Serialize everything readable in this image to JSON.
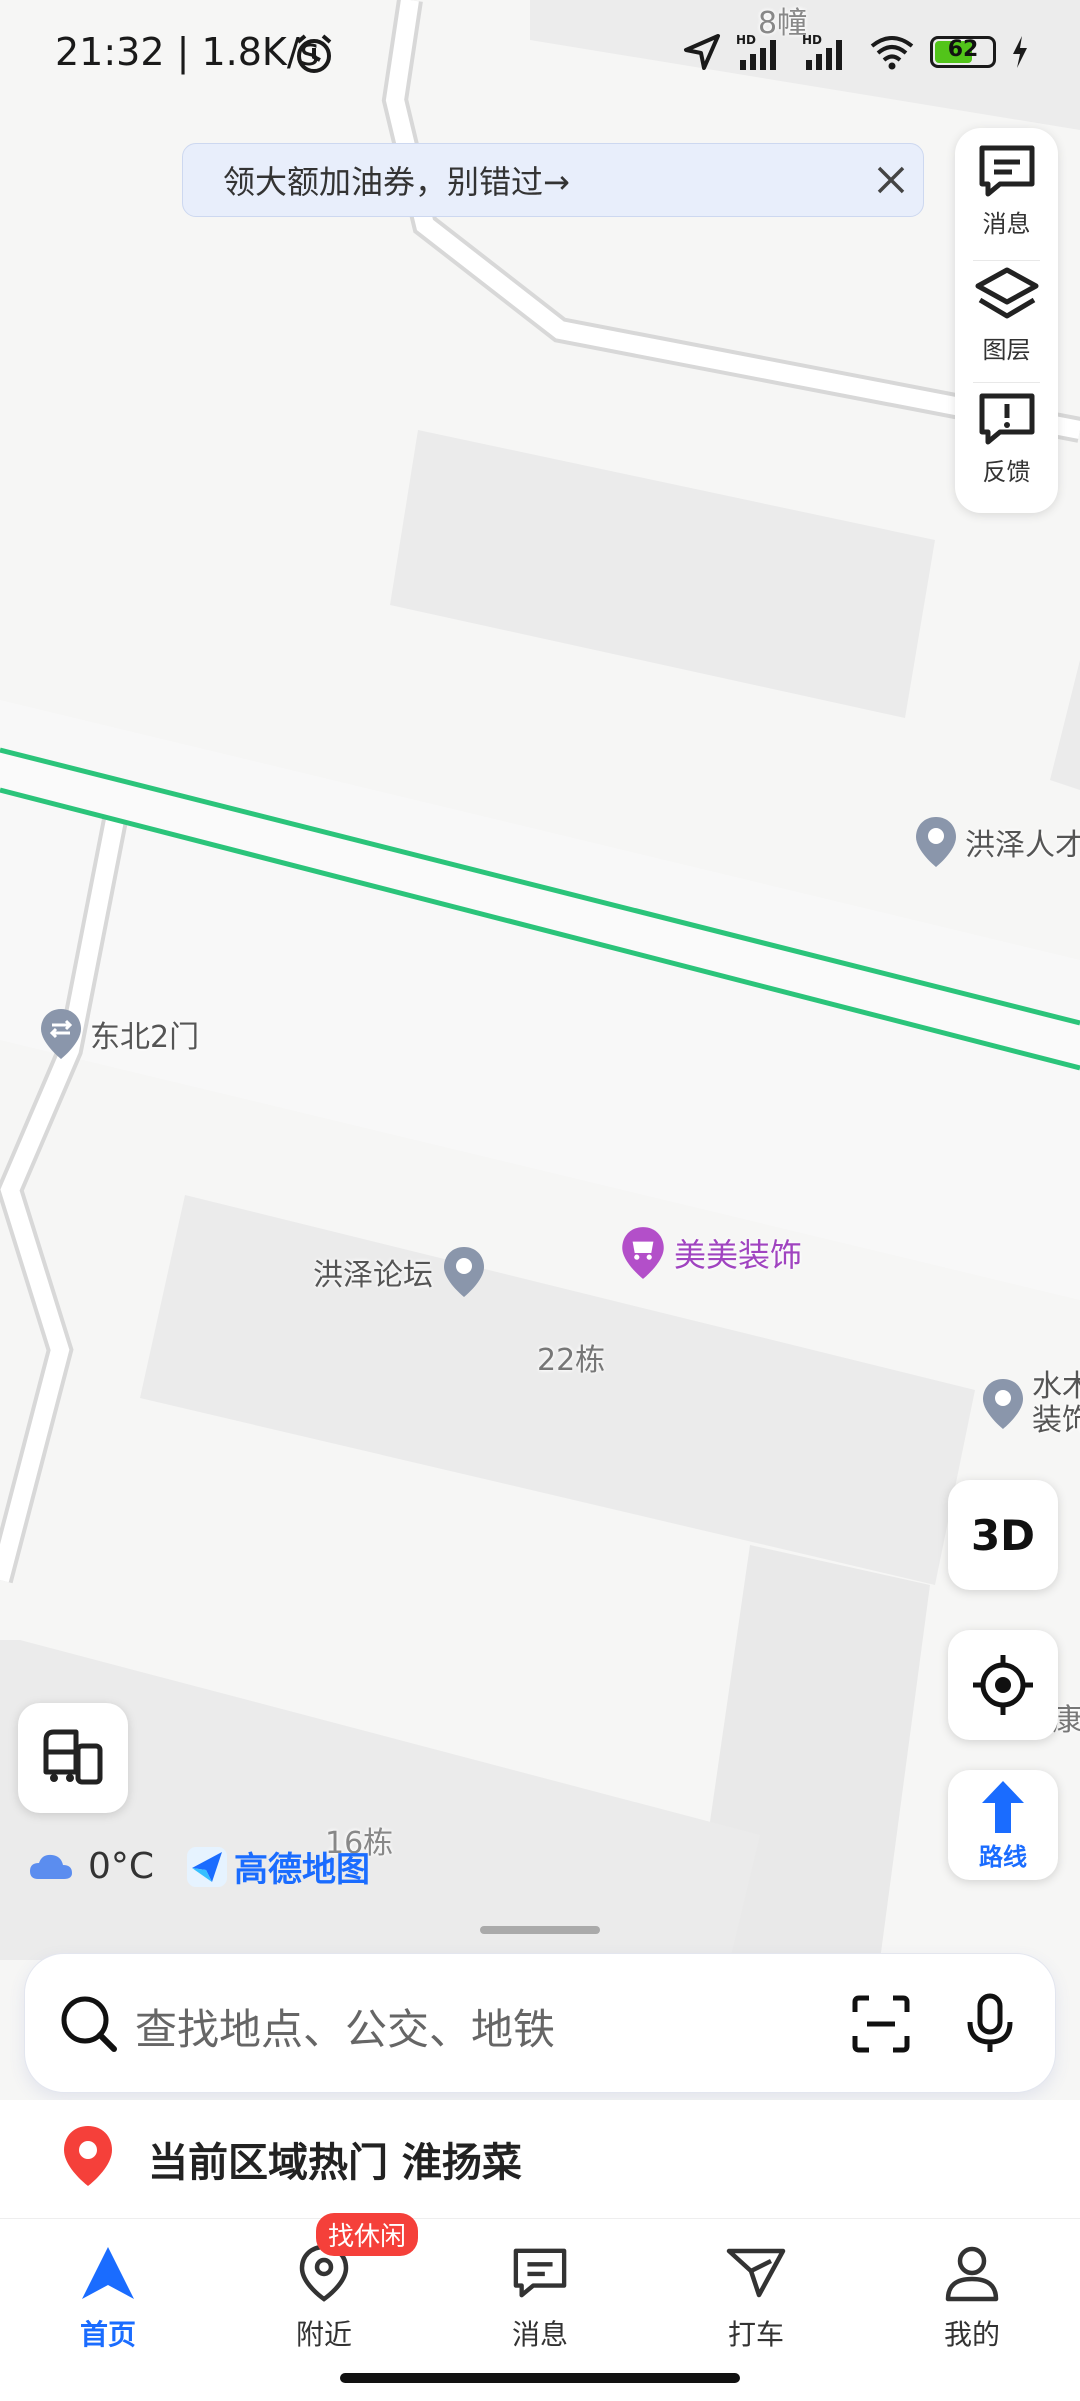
{
  "status_bar": {
    "time": "21:32 | 1.8K/s",
    "battery": "62"
  },
  "promo_banner": {
    "text": "领大额加油券，别错过→"
  },
  "map_tools": [
    {
      "label": "消息",
      "icon": "message-icon"
    },
    {
      "label": "图层",
      "icon": "layers-icon"
    },
    {
      "label": "反馈",
      "icon": "feedback-icon"
    }
  ],
  "map_labels": {
    "building_8": "8幢",
    "hongze_people": "洪泽人才",
    "northeast_gate": "东北2门",
    "hongze_forum": "洪泽论坛",
    "meimei_decor": "美美装饰",
    "building_22": "22栋",
    "water_decor_1": "水木",
    "water_decor_2": "装饰",
    "building_16": "16栋",
    "edge_label": "康"
  },
  "floating": {
    "btn_3d": "3D",
    "route_label": "路线"
  },
  "weather": {
    "temp": "0°C"
  },
  "logo": {
    "name": "高德地图"
  },
  "search": {
    "placeholder": "查找地点、公交、地铁"
  },
  "hot": {
    "text": "当前区域热门 淮扬菜"
  },
  "tabs": [
    {
      "label": "首页",
      "icon": "navigation-arrow-icon",
      "active": true
    },
    {
      "label": "附近",
      "icon": "location-pin-icon",
      "badge": "找休闲"
    },
    {
      "label": "消息",
      "icon": "message-icon"
    },
    {
      "label": "打车",
      "icon": "taxi-icon"
    },
    {
      "label": "我的",
      "icon": "profile-icon"
    }
  ],
  "colors": {
    "accent": "#1a6cff",
    "road_green": "#2bc47a",
    "badge_red": "#f5403a"
  }
}
